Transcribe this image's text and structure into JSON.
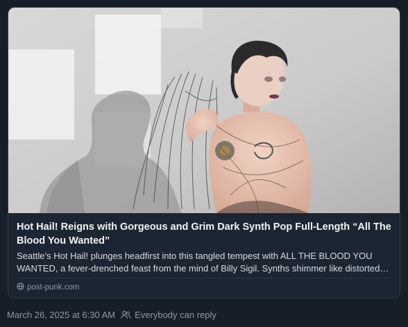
{
  "link_card": {
    "title": "Hot Hail! Reigns with Gorgeous and Grim Dark Synth Pop Full-Length “All The Blood You Wanted”",
    "description": "Seattle’s Hot Hail! plunges headfirst into this tangled tempest with ALL THE BLOOD YOU WANTED, a fever-drenched feast from the mind of Billy Sigil. Synths shimmer like distorted memories, pulling you deeper into the dark.",
    "source": "post-punk.com",
    "source_icon": "globe-icon",
    "image_alt": "shirtless person with dark hair in front of a wall with window light"
  },
  "post_meta": {
    "timestamp": "March 26, 2025 at 6:30 AM",
    "reply_setting": "Everybody can reply",
    "reply_icon": "people-icon"
  },
  "colors": {
    "background": "#161e27",
    "card_background": "#1c2632",
    "card_border": "#2e3a48",
    "title_text": "#f1f3f5",
    "body_text": "#d6dbe1",
    "muted_text": "#8e99a6"
  }
}
